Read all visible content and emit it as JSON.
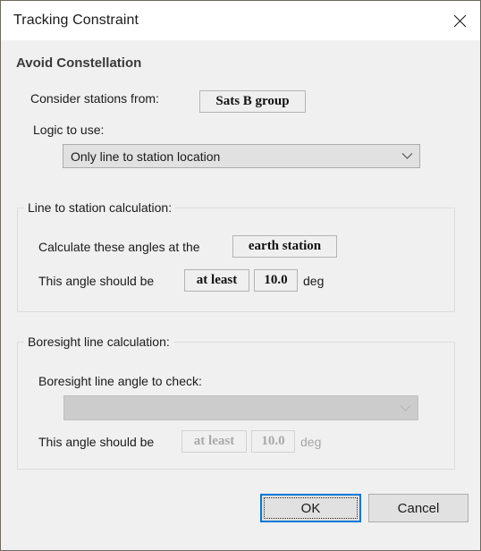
{
  "window": {
    "title": "Tracking Constraint",
    "close_icon": "close-icon"
  },
  "section": {
    "heading": "Avoid Constellation"
  },
  "stations": {
    "label": "Consider stations from:",
    "value": "Sats B group"
  },
  "logic": {
    "label": "Logic to use:",
    "value": "Only line to station location",
    "chevron_icon": "chevron-down-icon"
  },
  "line_group": {
    "legend": "Line to station calculation:",
    "calc_label": "Calculate these angles at the",
    "calc_value": "earth station",
    "angle_label": "This angle should be",
    "comparator": "at least",
    "angle_value": "10.0",
    "units": "deg"
  },
  "boresight_group": {
    "legend": "Boresight line calculation:",
    "angle_to_check_label": "Boresight line angle to check:",
    "combo_value": "",
    "chevron_icon": "chevron-down-icon",
    "angle_label": "This angle should be",
    "comparator": "at least",
    "angle_value": "10.0",
    "units": "deg"
  },
  "footer": {
    "ok_label": "OK",
    "cancel_label": "Cancel"
  },
  "colors": {
    "accent": "#0078d7",
    "window_bg": "#f0f0f0",
    "titlebar_bg": "#ffffff",
    "disabled_text": "#a9a9a9"
  }
}
